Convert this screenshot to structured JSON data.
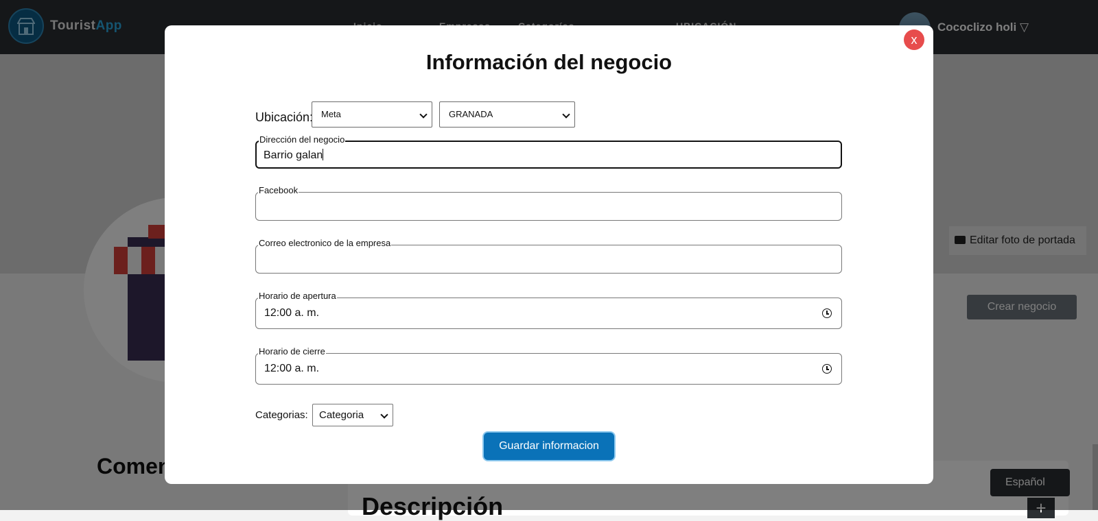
{
  "navbar": {
    "logo_part1": "Tourist",
    "logo_part2": "App",
    "links": [
      "Inicio",
      "Empresas",
      "Categorías",
      "UBICACIÓN"
    ],
    "user_name": "Cococlizo holi ▽"
  },
  "background": {
    "edit_cover_label": "Editar foto de portada",
    "create_business_label": "Crear negocio",
    "comments_title": "Comen",
    "description_title": "Descripción",
    "language_select": "Español",
    "plus_label": "+"
  },
  "modal": {
    "close_label": "x",
    "title": "Información del negocio",
    "location": {
      "label": "Ubicación:",
      "department": "Meta",
      "city": "GRANADA"
    },
    "fields": {
      "address": {
        "legend": "Dirección del negocio",
        "value": "Barrio galan"
      },
      "facebook": {
        "legend": "Facebook",
        "value": ""
      },
      "email": {
        "legend": "Correo electronico de la empresa",
        "value": ""
      },
      "opening": {
        "legend": "Horario de apertura",
        "value": "12:00 a. m."
      },
      "closing": {
        "legend": "Horario de cierre",
        "value": "12:00 a. m."
      }
    },
    "categories": {
      "label": "Categorias:",
      "selected": "Categoria"
    },
    "save_label": "Guardar informacion"
  },
  "colors": {
    "navbar": "#2b2f33",
    "accent_blue": "#0a72b8",
    "close_red": "#e74c4c"
  }
}
